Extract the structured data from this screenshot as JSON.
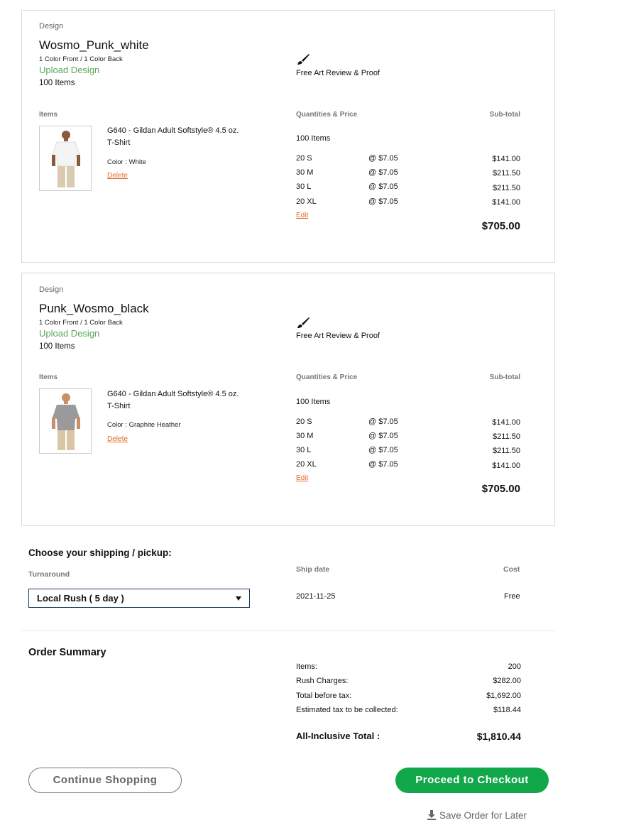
{
  "cards": [
    {
      "design_label": "Design",
      "design_name": "Wosmo_Punk_white",
      "colors_info": "1 Color Front / 1 Color Back",
      "upload_label": "Upload Design",
      "items_count": "100 Items",
      "art_review": "Free Art Review & Proof",
      "items_header": "Items",
      "qp_header": "Quantities & Price",
      "subtotal_header": "Sub-total",
      "product_name": "G640 - Gildan Adult Softstyle® 4.5 oz. T-Shirt",
      "color_text": "Color : White",
      "delete_label": "Delete",
      "qty_total": "100 Items",
      "rows": [
        {
          "size": "20 S",
          "price": "@ $7.05",
          "subtotal": "$141.00"
        },
        {
          "size": "30 M",
          "price": "@ $7.05",
          "subtotal": "$211.50"
        },
        {
          "size": "30 L",
          "price": "@ $7.05",
          "subtotal": "$211.50"
        },
        {
          "size": "20 XL",
          "price": "@ $7.05",
          "subtotal": "$141.00"
        }
      ],
      "edit_label": "Edit",
      "total": "$705.00",
      "shirt_color": "#f4f4f4"
    },
    {
      "design_label": "Design",
      "design_name": "Punk_Wosmo_black",
      "colors_info": "1 Color Front / 1 Color Back",
      "upload_label": "Upload Design",
      "items_count": "100 Items",
      "art_review": "Free Art Review & Proof",
      "items_header": "Items",
      "qp_header": "Quantities & Price",
      "subtotal_header": "Sub-total",
      "product_name": "G640 - Gildan Adult Softstyle® 4.5 oz. T-Shirt",
      "color_text": "Color : Graphite Heather",
      "delete_label": "Delete",
      "qty_total": "100 Items",
      "rows": [
        {
          "size": "20 S",
          "price": "@ $7.05",
          "subtotal": "$141.00"
        },
        {
          "size": "30 M",
          "price": "@ $7.05",
          "subtotal": "$211.50"
        },
        {
          "size": "30 L",
          "price": "@ $7.05",
          "subtotal": "$211.50"
        },
        {
          "size": "20 XL",
          "price": "@ $7.05",
          "subtotal": "$141.00"
        }
      ],
      "edit_label": "Edit",
      "total": "$705.00",
      "shirt_color": "#9a9a9a"
    }
  ],
  "shipping": {
    "heading": "Choose your shipping / pickup:",
    "turnaround_label": "Turnaround",
    "selected": "Local Rush ( 5 day )",
    "ship_date_label": "Ship date",
    "cost_label": "Cost",
    "ship_date": "2021-11-25",
    "cost": "Free"
  },
  "summary": {
    "heading": "Order Summary",
    "rows": [
      {
        "label": "Items:",
        "value": "200"
      },
      {
        "label": "Rush Charges:",
        "value": "$282.00"
      },
      {
        "label": "Total before tax:",
        "value": "$1,692.00"
      },
      {
        "label": "Estimated tax to be collected:",
        "value": "$118.44"
      }
    ],
    "total_label": "All-Inclusive Total :",
    "total_value": "$1,810.44"
  },
  "actions": {
    "continue_label": "Continue Shopping",
    "checkout_label": "Proceed to Checkout",
    "save_label": "Save Order for Later"
  },
  "colors": {
    "accent_green": "#11a84b",
    "link_orange": "#e2692a",
    "upload_green": "#5aa85a"
  }
}
